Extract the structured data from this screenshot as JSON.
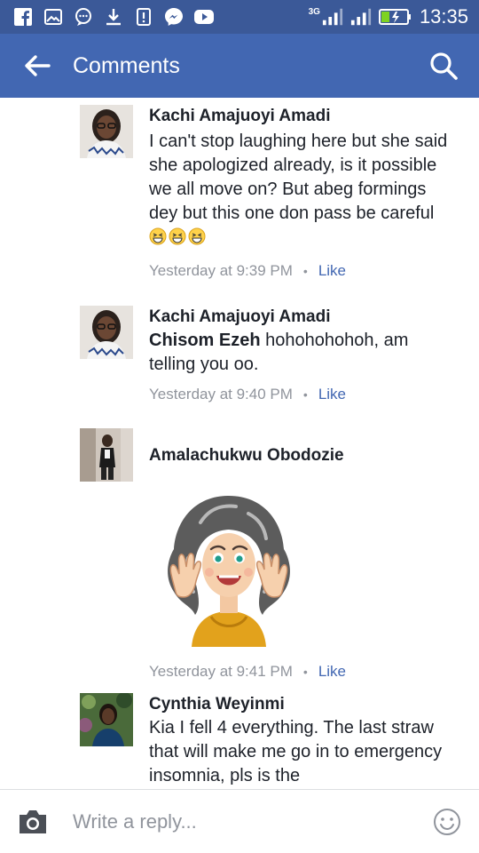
{
  "status_bar": {
    "network": "3G",
    "time": "13:35",
    "icons": [
      "facebook-icon",
      "gallery-icon",
      "chat-bubble-icon",
      "download-icon",
      "alert-icon",
      "messenger-icon",
      "video-icon",
      "signal-icon",
      "signal-icon",
      "battery-charging-icon"
    ]
  },
  "app_bar": {
    "title": "Comments",
    "back_icon": "arrow-left-icon",
    "search_icon": "search-icon"
  },
  "comments": [
    {
      "author": "Kachi Amajuoyi Amadi",
      "text": "I can't stop laughing here but she said she apologized already, is it possible we all move on? But abeg formings dey but this one don pass be careful",
      "emoji": [
        "grinning-squint-emoji",
        "grinning-squint-emoji",
        "grinning-squint-emoji"
      ],
      "time": "Yesterday at 9:39 PM",
      "like_label": "Like"
    },
    {
      "author": "Kachi Amajuoyi Amadi",
      "mention": "Chisom Ezeh",
      "text": " hohohohohoh, am telling you oo.",
      "time": "Yesterday at 9:40 PM",
      "like_label": "Like"
    },
    {
      "author": "Amalachukwu Obodozie",
      "sticker": "laughing-woman-sticker",
      "time": "Yesterday at 9:41 PM",
      "like_label": "Like"
    },
    {
      "author": "Cynthia Weyinmi",
      "text": "Kia I fell 4 everything. The last straw that will make me go in to emergency insomnia,  pls is the"
    }
  ],
  "composer": {
    "placeholder": "Write a reply...",
    "camera_icon": "camera-icon",
    "emoji_icon": "smiley-icon"
  },
  "colors": {
    "status_bar": "#3b5998",
    "app_bar": "#4267b2",
    "link": "#4267b2",
    "meta": "#90949c",
    "text": "#1d2129"
  }
}
